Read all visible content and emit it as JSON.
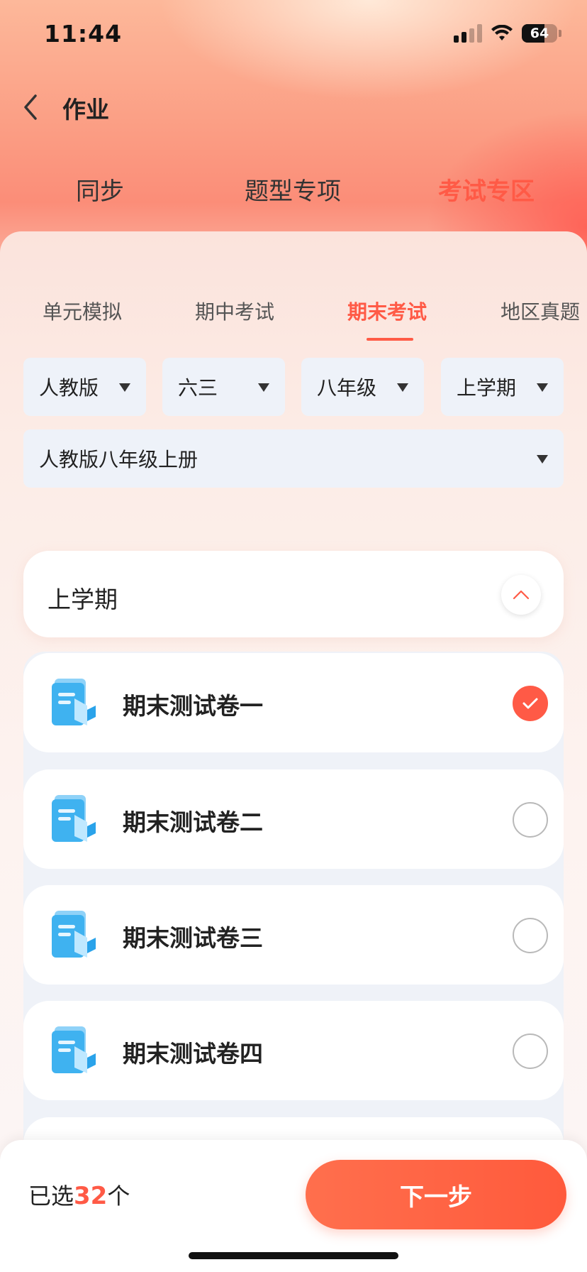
{
  "status_bar": {
    "time": "11:44",
    "battery": "64"
  },
  "nav": {
    "title": "作业"
  },
  "top_tabs": [
    {
      "label": "同步",
      "active": false
    },
    {
      "label": "题型专项",
      "active": false
    },
    {
      "label": "考试专区",
      "active": true
    }
  ],
  "sub_tabs": [
    {
      "label": "单元模拟",
      "active": false
    },
    {
      "label": "期中考试",
      "active": false
    },
    {
      "label": "期末考试",
      "active": true
    },
    {
      "label": "地区真题",
      "active": false
    }
  ],
  "filters": {
    "edition": "人教版",
    "system": "六三",
    "grade": "八年级",
    "term": "上学期",
    "book": "人教版八年级上册"
  },
  "section": {
    "title": "上学期"
  },
  "papers": [
    {
      "title": "期末测试卷一",
      "selected": true
    },
    {
      "title": "期末测试卷二",
      "selected": false
    },
    {
      "title": "期末测试卷三",
      "selected": false
    },
    {
      "title": "期末测试卷四",
      "selected": false
    }
  ],
  "bottom": {
    "selected_prefix": "已选",
    "selected_count": "32",
    "selected_suffix": "个",
    "next_label": "下一步"
  },
  "colors": {
    "accent": "#ff5a46",
    "dropdown_bg": "#eef2f9"
  }
}
